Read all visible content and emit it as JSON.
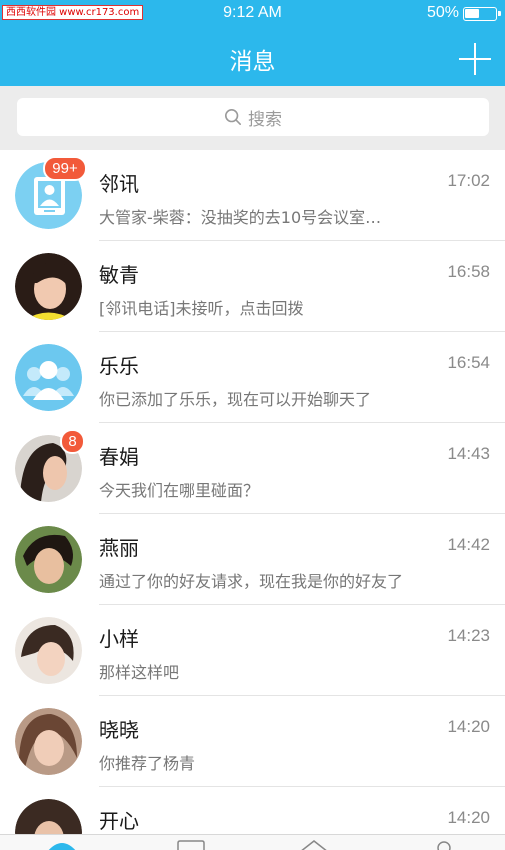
{
  "status_bar": {
    "watermark": "西西软件园 www.cr173.com",
    "time": "9:12 AM",
    "battery": "50%"
  },
  "header": {
    "title": "消息"
  },
  "search": {
    "placeholder": "搜索"
  },
  "colors": {
    "accent": "#2cb8ec",
    "badge": "#f25a3a"
  },
  "conversations": [
    {
      "name": "邻讯",
      "time": "17:02",
      "preview": "大管家-柴蓉：没抽奖的去10号会议室…",
      "badge": "99+",
      "avatar": "app-contact-icon"
    },
    {
      "name": "敏青",
      "time": "16:58",
      "preview": "[邻讯电话]未接听，点击回拨",
      "badge": "",
      "avatar": "photo"
    },
    {
      "name": "乐乐",
      "time": "16:54",
      "preview": "你已添加了乐乐，现在可以开始聊天了",
      "badge": "",
      "avatar": "default-user-icon"
    },
    {
      "name": "春娟",
      "time": "14:43",
      "preview": "今天我们在哪里碰面？",
      "badge": "8",
      "avatar": "photo"
    },
    {
      "name": "燕丽",
      "time": "14:42",
      "preview": "通过了你的好友请求，现在我是你的好友了",
      "badge": "",
      "avatar": "photo"
    },
    {
      "name": "小样",
      "time": "14:23",
      "preview": "那样这样吧",
      "badge": "",
      "avatar": "photo"
    },
    {
      "name": "晓晓",
      "time": "14:20",
      "preview": "你推荐了杨青",
      "badge": "",
      "avatar": "photo"
    },
    {
      "name": "开心",
      "time": "14:20",
      "preview": "",
      "badge": "",
      "avatar": "photo"
    }
  ]
}
